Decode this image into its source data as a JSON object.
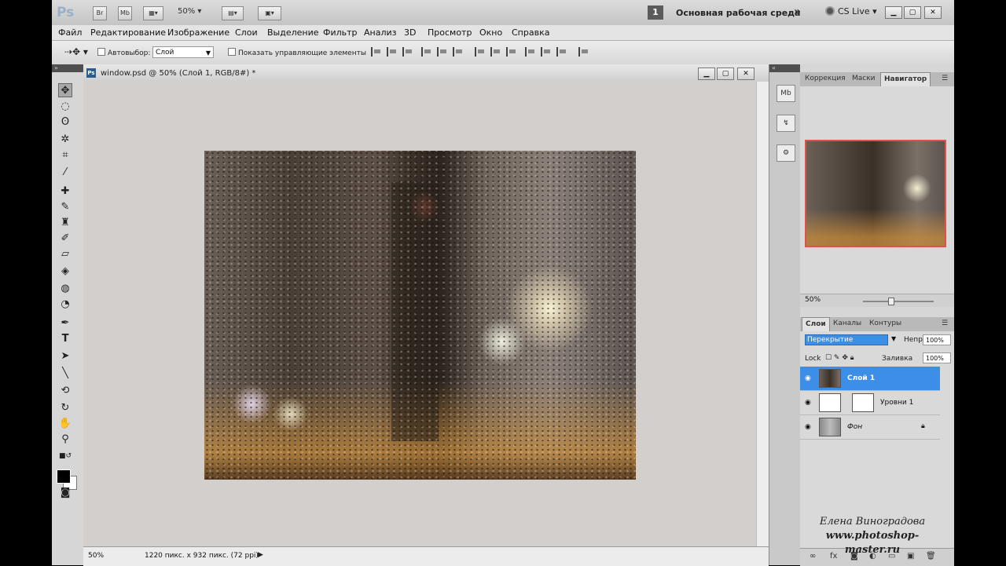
{
  "titlebar": {
    "logo": "Ps",
    "bridge_btn": "Br",
    "mini_bridge_btn": "Mb",
    "zoom": "50%",
    "workspace_number": "1",
    "workspace_name": "Основная рабочая среда",
    "cs_live": "CS Live"
  },
  "menu": [
    "Файл",
    "Редактирование",
    "Изображение",
    "Слои",
    "Выделение",
    "Фильтр",
    "Анализ",
    "3D",
    "Просмотр",
    "Окно",
    "Справка"
  ],
  "options": {
    "autoselect_label": "Автовыбор:",
    "autoselect_value": "Слой",
    "show_controls_label": "Показать управляющие элементы"
  },
  "document": {
    "title": "window.psd @ 50% (Слой 1, RGB/8#) *",
    "status_zoom": "50%",
    "status_info": "1220 пикс. x 932 пикс. (72 ppi)"
  },
  "panels": {
    "top_tabs": [
      "Коррекция",
      "Маски",
      "Навигатор"
    ],
    "navigator_zoom": "50%",
    "layer_tabs": [
      "Слои",
      "Каналы",
      "Контуры"
    ],
    "blend_mode": "Перекрытие",
    "opacity_label": "Непр",
    "opacity_value": "100%",
    "lock_label": "Lock",
    "fill_label": "Заливка",
    "fill_value": "100%",
    "layers": [
      {
        "name": "Слой 1",
        "selected": true
      },
      {
        "name": "Уровни 1",
        "selected": false
      },
      {
        "name": "Фон",
        "selected": false
      }
    ]
  },
  "watermark": {
    "line1": "Елена Виноградова",
    "line2": "www.photoshop-master.ru"
  },
  "colors": {
    "selection_blue": "#3d8ee6",
    "navigator_frame": "#e2504a"
  }
}
